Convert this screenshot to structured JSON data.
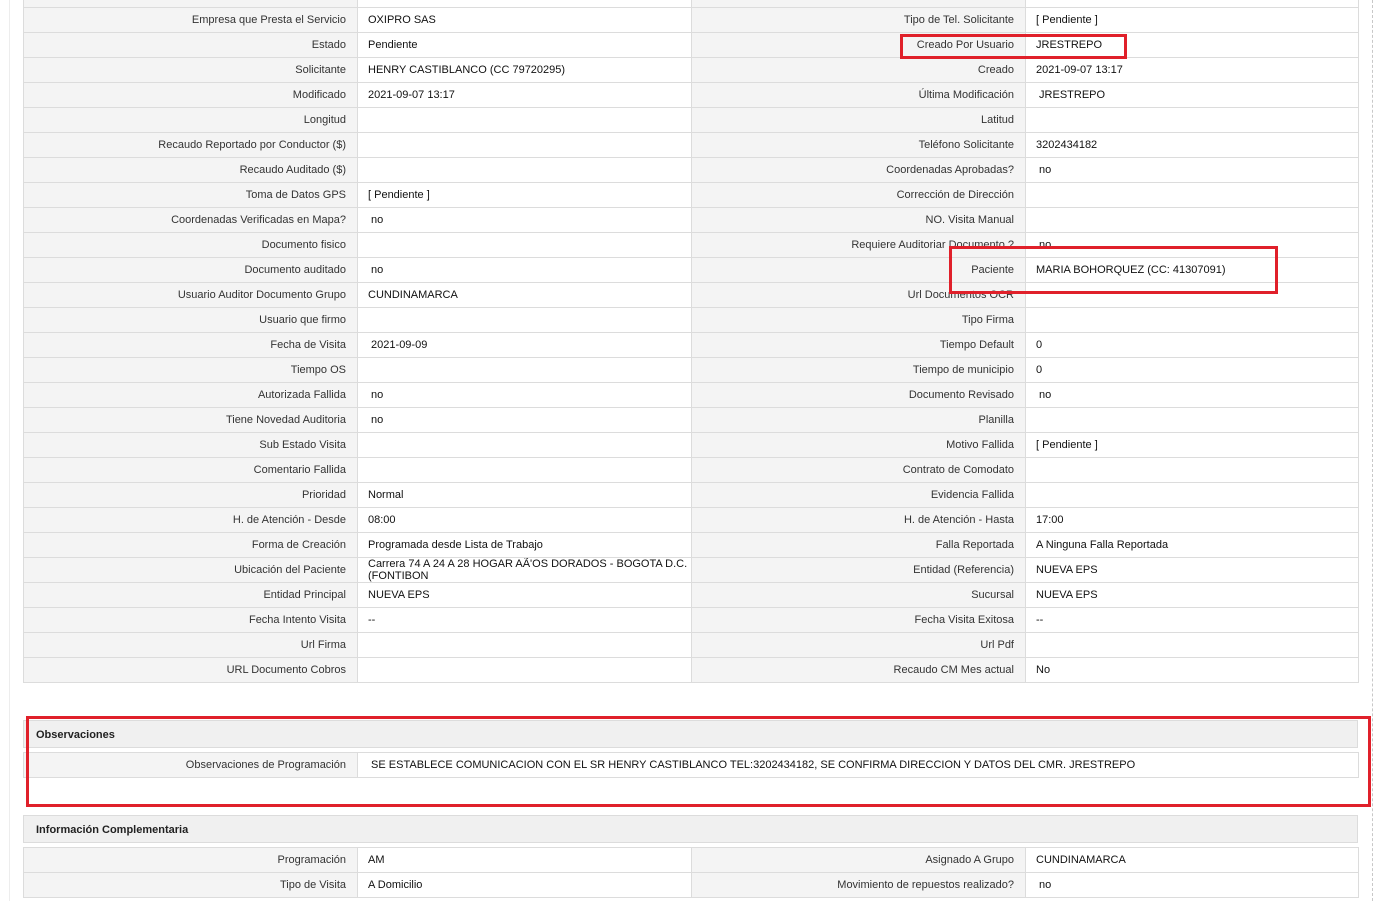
{
  "main_rows": [
    {
      "l1": "Empresa que Presta el Servicio",
      "v1": "OXIPRO SAS",
      "l2": "Tipo de Tel. Solicitante",
      "v2": "[ Pendiente ]"
    },
    {
      "l1": "Estado",
      "v1": "Pendiente",
      "l2": "Creado Por Usuario",
      "v2": "JRESTREPO"
    },
    {
      "l1": "Solicitante",
      "v1": "HENRY CASTIBLANCO (CC 79720295)",
      "l2": "Creado",
      "v2": "2021-09-07 13:17"
    },
    {
      "l1": "Modificado",
      "v1": "2021-09-07 13:17",
      "l2": "Última Modificación",
      "v2": " JRESTREPO"
    },
    {
      "l1": "Longitud",
      "v1": "",
      "l2": "Latitud",
      "v2": ""
    },
    {
      "l1": "Recaudo Reportado por Conductor ($)",
      "v1": "",
      "l2": "Teléfono Solicitante",
      "v2": "3202434182"
    },
    {
      "l1": "Recaudo Auditado ($)",
      "v1": "",
      "l2": "Coordenadas Aprobadas?",
      "v2": " no"
    },
    {
      "l1": "Toma de Datos GPS",
      "v1": "[ Pendiente ]",
      "l2": "Corrección de Dirección",
      "v2": ""
    },
    {
      "l1": "Coordenadas Verificadas en Mapa?",
      "v1": " no",
      "l2": "NO. Visita Manual",
      "v2": ""
    },
    {
      "l1": "Documento fisico",
      "v1": "",
      "l2": "Requiere Auditoriar Documento ?",
      "v2": " no"
    },
    {
      "l1": "Documento auditado",
      "v1": " no",
      "l2": "Paciente",
      "v2": "MARIA BOHORQUEZ (CC: 41307091)"
    },
    {
      "l1": "Usuario Auditor Documento Grupo",
      "v1": "CUNDINAMARCA",
      "l2": "Url Documentos OCR",
      "v2": ""
    },
    {
      "l1": "Usuario que firmo",
      "v1": "",
      "l2": "Tipo Firma",
      "v2": ""
    },
    {
      "l1": "Fecha de Visita",
      "v1": " 2021-09-09",
      "l2": "Tiempo Default",
      "v2": "0"
    },
    {
      "l1": "Tiempo OS",
      "v1": "",
      "l2": "Tiempo de municipio",
      "v2": "0"
    },
    {
      "l1": "Autorizada Fallida",
      "v1": " no",
      "l2": "Documento Revisado",
      "v2": " no"
    },
    {
      "l1": "Tiene Novedad Auditoria",
      "v1": " no",
      "l2": "Planilla",
      "v2": ""
    },
    {
      "l1": "Sub Estado Visita",
      "v1": "",
      "l2": "Motivo Fallida",
      "v2": "[ Pendiente ]"
    },
    {
      "l1": "Comentario Fallida",
      "v1": "",
      "l2": "Contrato de Comodato",
      "v2": ""
    },
    {
      "l1": "Prioridad",
      "v1": "Normal",
      "l2": "Evidencia Fallida",
      "v2": ""
    },
    {
      "l1": "H. de Atención - Desde",
      "v1": "08:00",
      "l2": "H. de Atención - Hasta",
      "v2": "17:00"
    },
    {
      "l1": "Forma de Creación",
      "v1": "Programada desde Lista de Trabajo",
      "l2": "Falla Reportada",
      "v2": "A Ninguna Falla Reportada"
    },
    {
      "l1": "Ubicación del Paciente",
      "v1": "Carrera 74 A 24 A 28 HOGAR AÃ'OS DORADOS - BOGOTA D.C. (FONTIBON",
      "l2": "Entidad (Referencia)",
      "v2": "NUEVA EPS"
    },
    {
      "l1": "Entidad Principal",
      "v1": "NUEVA EPS",
      "l2": "Sucursal",
      "v2": "NUEVA EPS"
    },
    {
      "l1": "Fecha Intento Visita",
      "v1": "--",
      "l2": "Fecha Visita Exitosa",
      "v2": "--"
    },
    {
      "l1": "Url Firma",
      "v1": "",
      "l2": "Url Pdf",
      "v2": ""
    },
    {
      "l1": "URL Documento Cobros",
      "v1": "",
      "l2": "Recaudo CM Mes actual",
      "v2": "No"
    }
  ],
  "observaciones": {
    "title": "Observaciones",
    "label": "Observaciones de Programación",
    "value": " SE ESTABLECE COMUNICACION CON EL SR HENRY CASTIBLANCO TEL:3202434182, SE CONFIRMA DIRECCION Y DATOS DEL CMR. JRESTREPO"
  },
  "info": {
    "title": "Información Complementaria",
    "rows": [
      {
        "l1": "Programación",
        "v1": "AM",
        "l2": "Asignado A Grupo",
        "v2": "CUNDINAMARCA"
      },
      {
        "l1": "Tipo de Visita",
        "v1": "A Domicilio",
        "l2": "Movimiento de repuestos realizado?",
        "v2": " no"
      }
    ]
  },
  "highlight_color": "#e0202a"
}
